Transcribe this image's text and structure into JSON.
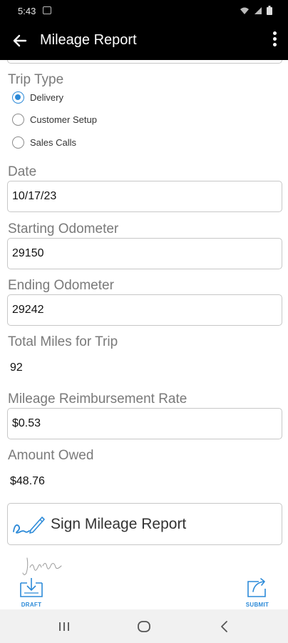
{
  "status_bar": {
    "time": "5:43"
  },
  "app_bar": {
    "title": "Mileage Report"
  },
  "trip_type": {
    "label": "Trip Type",
    "options": [
      {
        "label": "Delivery",
        "checked": true
      },
      {
        "label": "Customer Setup",
        "checked": false
      },
      {
        "label": "Sales Calls",
        "checked": false
      }
    ]
  },
  "date": {
    "label": "Date",
    "value": "10/17/23"
  },
  "starting_odometer": {
    "label": "Starting Odometer",
    "value": "29150"
  },
  "ending_odometer": {
    "label": "Ending Odometer",
    "value": "29242"
  },
  "total_miles": {
    "label": "Total Miles for Trip",
    "value": "92"
  },
  "reimbursement_rate": {
    "label": "Mileage Reimbursement Rate",
    "value": "$0.53"
  },
  "amount_owed": {
    "label": "Amount Owed",
    "value": "$48.76"
  },
  "sign_button": {
    "label": "Sign Mileage Report"
  },
  "actions": {
    "draft_label": "DRAFT",
    "submit_label": "SUBMIT"
  },
  "colors": {
    "accent": "#2c8ad8",
    "appbar_bg": "#000000"
  }
}
